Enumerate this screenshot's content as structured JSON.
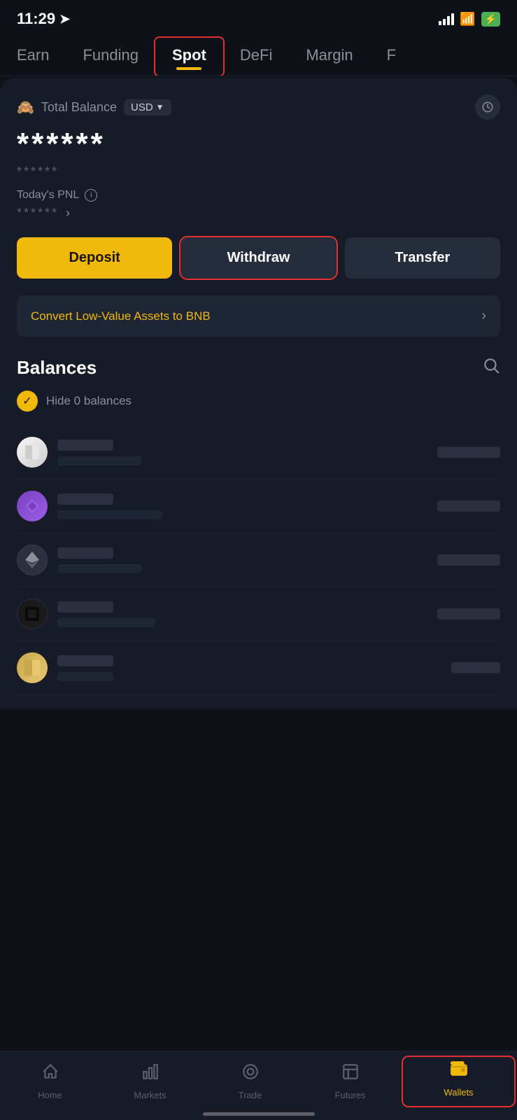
{
  "statusBar": {
    "time": "11:29",
    "navArrow": "➤"
  },
  "navTabs": {
    "items": [
      {
        "id": "earn",
        "label": "Earn",
        "active": false
      },
      {
        "id": "funding",
        "label": "Funding",
        "active": false
      },
      {
        "id": "spot",
        "label": "Spot",
        "active": true
      },
      {
        "id": "defi",
        "label": "DeFi",
        "active": false
      },
      {
        "id": "margin",
        "label": "Margin",
        "active": false
      },
      {
        "id": "f",
        "label": "F",
        "active": false
      }
    ]
  },
  "balance": {
    "label": "Total Balance",
    "currency": "USD",
    "currencyArrow": "▼",
    "stars": "******",
    "subStars": "******",
    "pnlLabel": "Today's PNL",
    "pnlStars": "******",
    "pnlArrow": "›"
  },
  "buttons": {
    "deposit": "Deposit",
    "withdraw": "Withdraw",
    "transfer": "Transfer"
  },
  "convertBanner": {
    "text": "Convert Low-Value Assets to BNB",
    "arrow": "›"
  },
  "balancesSection": {
    "title": "Balances",
    "hideZeroLabel": "Hide 0 balances"
  },
  "bottomNav": {
    "items": [
      {
        "id": "home",
        "label": "Home",
        "active": false,
        "icon": "⌂"
      },
      {
        "id": "markets",
        "label": "Markets",
        "active": false,
        "icon": "📊"
      },
      {
        "id": "trade",
        "label": "Trade",
        "active": false,
        "icon": "◎"
      },
      {
        "id": "futures",
        "label": "Futures",
        "active": false,
        "icon": "📋"
      },
      {
        "id": "wallets",
        "label": "Wallets",
        "active": true,
        "icon": "👛"
      }
    ]
  }
}
